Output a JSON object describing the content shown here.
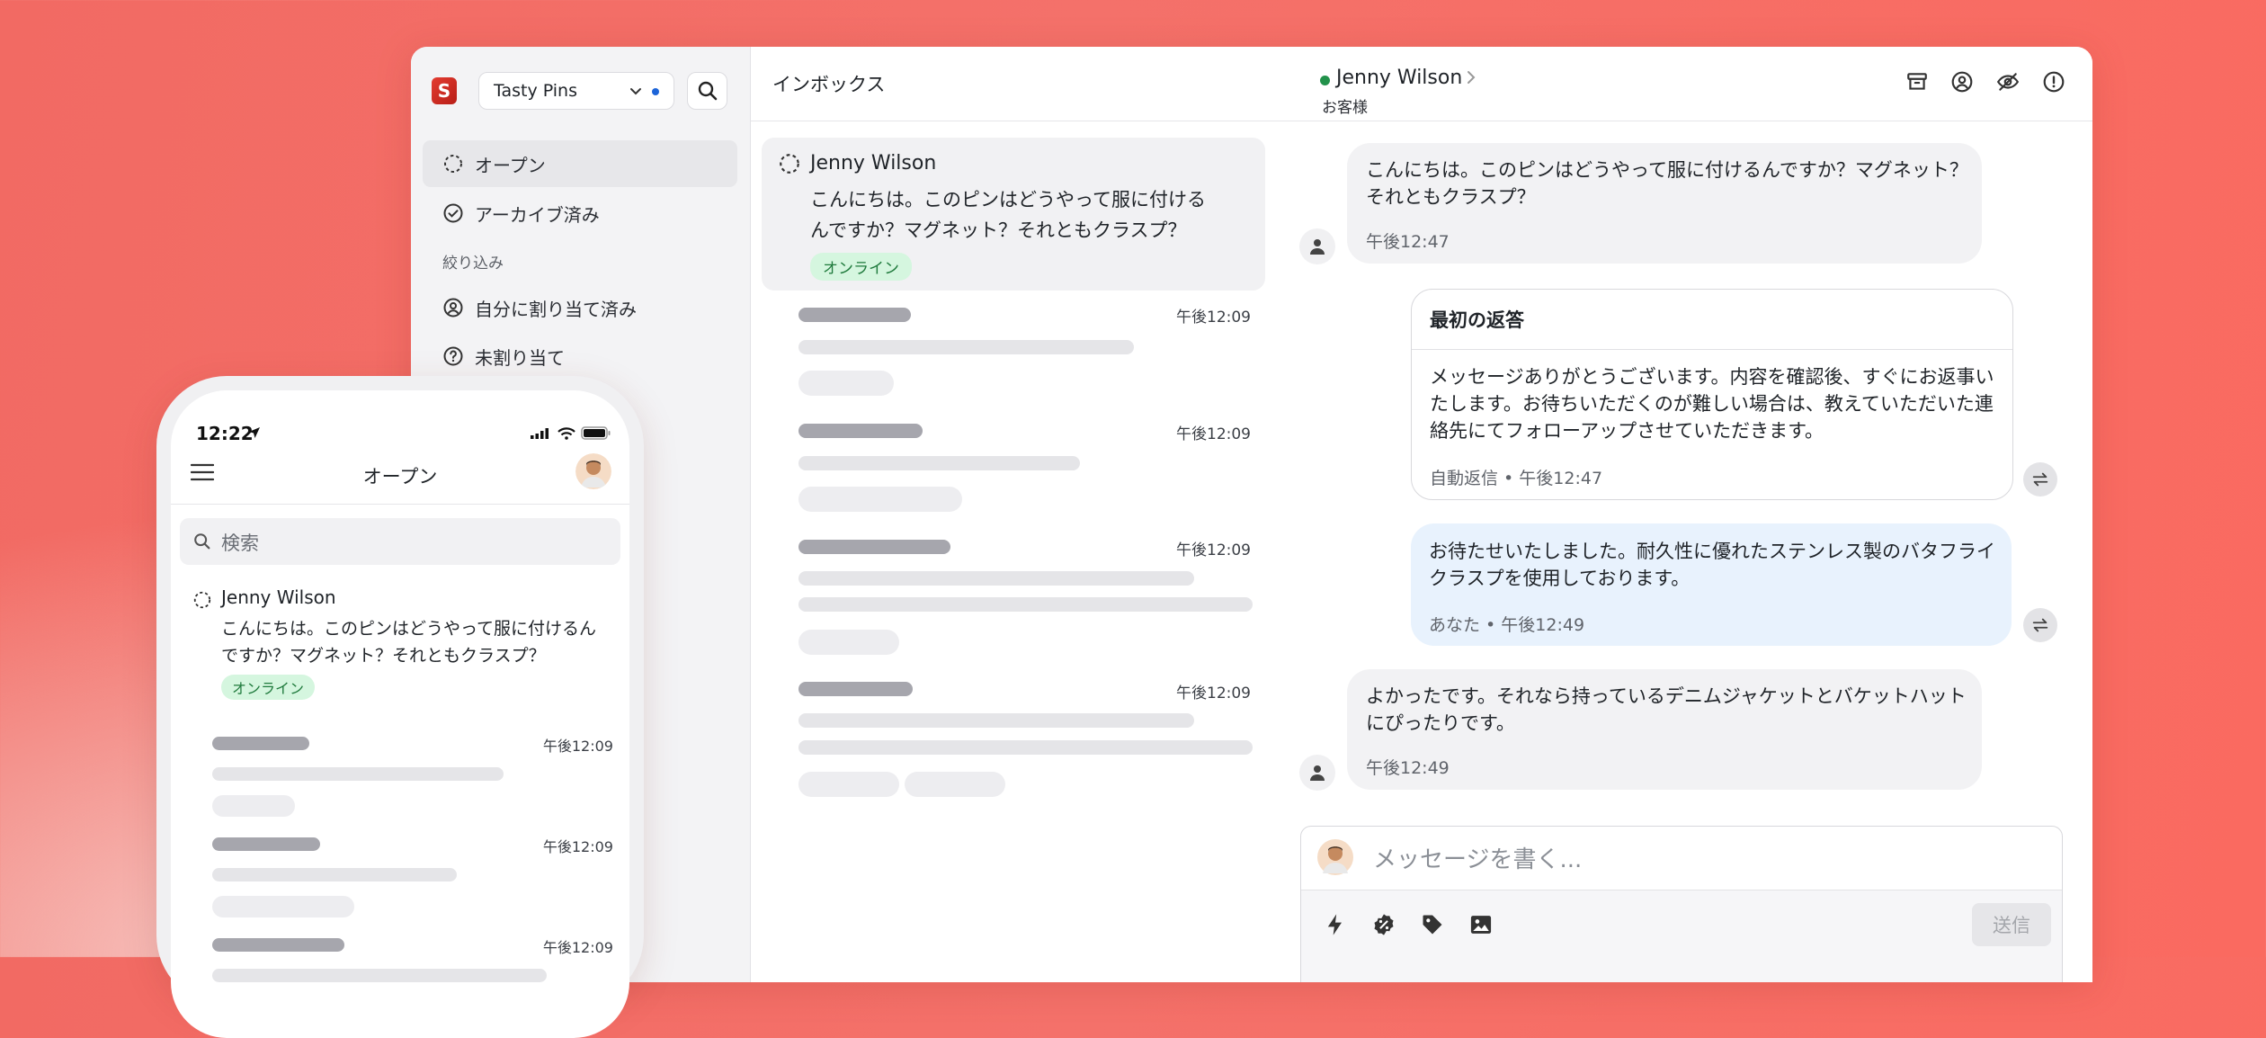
{
  "desktop": {
    "shop": {
      "name": "Tasty Pins",
      "indicator_color": "#1c64d8"
    },
    "nav": {
      "items": [
        {
          "label": "オープン",
          "icon": "loading-circle-icon",
          "active": true
        },
        {
          "label": "アーカイブ済み",
          "icon": "check-circle-icon",
          "active": false
        }
      ],
      "filter_heading": "絞り込み",
      "filters": [
        {
          "label": "自分に割り当て済み",
          "icon": "user-circle-icon"
        },
        {
          "label": "未割り当て",
          "icon": "question-circle-icon"
        }
      ]
    },
    "inbox": {
      "title": "インボックス",
      "active_conversation": {
        "name": "Jenny Wilson",
        "preview": "こんにちは。このピンはどうやって服に付けるんですか？マグネット？それともクラスプ？",
        "status": "オンライン"
      },
      "placeholder_times": [
        "午後12:09",
        "午後12:09",
        "午後12:09",
        "午後12:09"
      ]
    },
    "chat": {
      "customer_name": "Jenny Wilson",
      "customer_role": "お客様",
      "status_color": "#22924b",
      "header_icons": [
        "archive-icon",
        "assign-user-icon",
        "hide-icon",
        "alert-icon"
      ],
      "messages": [
        {
          "from": "customer",
          "text": "こんにちは。このピンはどうやって服に付けるんですか？マグネット？それともクラスプ？",
          "time": "午後12:47"
        },
        {
          "from": "auto",
          "title": "最初の返答",
          "text": "メッセージありがとうございます。内容を確認後、すぐにお返事いたします。お待ちいただくのが難しい場合は、教えていただいた連絡先にてフォローアップさせていただきます。",
          "meta": "自動返信 • 午後12:47"
        },
        {
          "from": "you",
          "text": "お待たせいたしました。耐久性に優れたステンレス製のバタフライクラスプを使用しております。",
          "meta": "あなた • 午後12:49"
        },
        {
          "from": "customer",
          "text": "よかったです。それなら持っているデニムジャケットとバケットハットにぴったりです。",
          "time": "午後12:49"
        }
      ],
      "composer": {
        "placeholder": "メッセージを書く...",
        "send_label": "送信",
        "tools": [
          "lightning-icon",
          "discount-icon",
          "tag-icon",
          "image-icon"
        ]
      }
    }
  },
  "phone": {
    "time": "12:22",
    "title": "オープン",
    "search_placeholder": "検索",
    "conversation": {
      "name": "Jenny Wilson",
      "preview": "こんにちは。このピンはどうやって服に付けるんですか？マグネット？それともクラスプ？",
      "status": "オンライン"
    },
    "placeholder_times": [
      "午後12:09",
      "午後12:09",
      "午後12:09"
    ]
  }
}
